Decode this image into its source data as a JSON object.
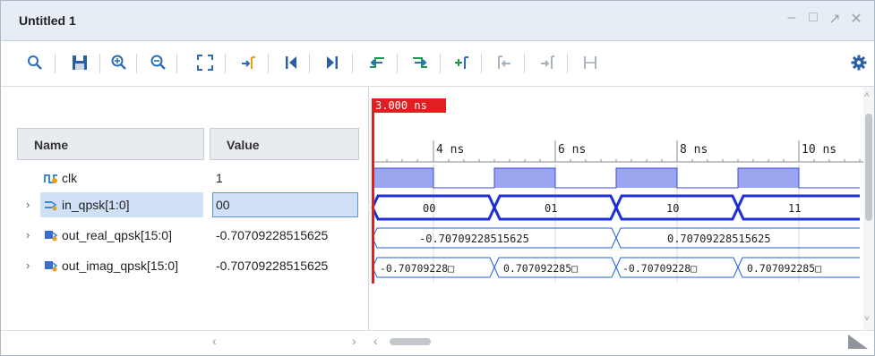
{
  "window": {
    "title": "Untitled 1"
  },
  "toolbar": {
    "icons": [
      "search-icon",
      "save-icon",
      "zoom-in-icon",
      "zoom-out-icon",
      "zoom-fit-icon",
      "go-to-cursor-icon",
      "go-to-start-icon",
      "go-to-end-icon",
      "previous-transition-icon",
      "next-transition-icon",
      "add-marker-icon",
      "previous-marker-icon",
      "next-marker-icon",
      "swap-cursors-icon",
      "settings-icon"
    ]
  },
  "columns": {
    "name": "Name",
    "value": "Value"
  },
  "signals": [
    {
      "name": "clk",
      "value": "1",
      "expandable": false
    },
    {
      "name": "in_qpsk[1:0]",
      "value": "00",
      "expandable": true
    },
    {
      "name": "out_real_qpsk[15:0]",
      "value": "-0.70709228515625",
      "expandable": true
    },
    {
      "name": "out_imag_qpsk[15:0]",
      "value": "-0.70709228515625",
      "expandable": true
    }
  ],
  "cursor": {
    "label": "3.000 ns",
    "color": "#e02020"
  },
  "timeline": {
    "ticks": [
      "4 ns",
      "6 ns",
      "8 ns",
      "10 ns"
    ]
  },
  "waves": {
    "in_qpsk": [
      "00",
      "01",
      "10",
      "11"
    ],
    "out_real": [
      "-0.70709228515625",
      "0.70709228515625"
    ],
    "out_imag": [
      "-0.70709228□",
      "0.707092285□",
      "-0.70709228□",
      "0.707092285□"
    ]
  },
  "colors": {
    "bus": "#1f2fd6",
    "clk_fill": "#9aa6f0",
    "bus_line": "#1e5fd8",
    "selected_row": "#cfe0f7"
  }
}
